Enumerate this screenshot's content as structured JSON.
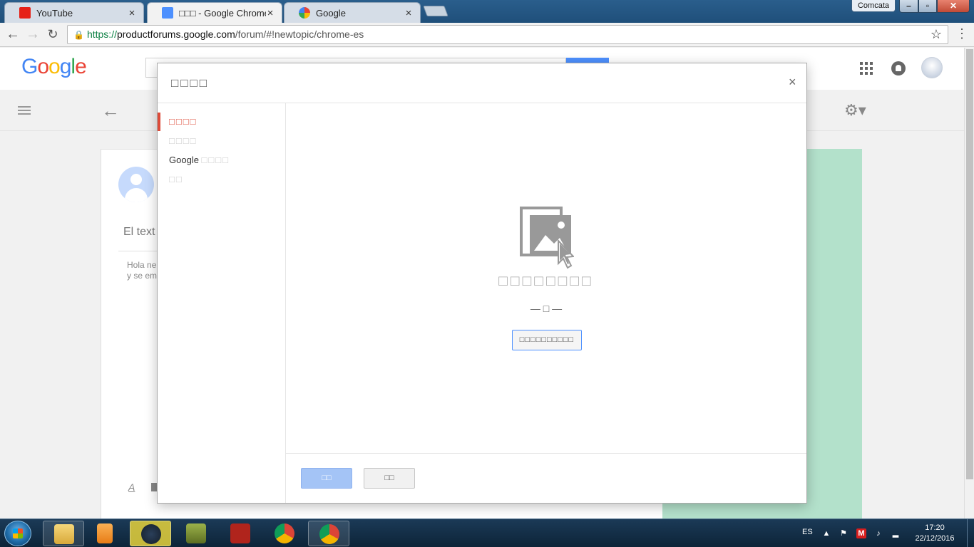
{
  "browser": {
    "tabs": [
      {
        "title": "YouTube",
        "favicon": "youtube-icon",
        "active": false
      },
      {
        "title": "□□□ - Google Chrome - □",
        "favicon": "product-forums-icon",
        "active": true
      },
      {
        "title": "Google",
        "favicon": "google-g-icon",
        "active": false
      }
    ],
    "profile_chip": "Comcata",
    "url": {
      "protocol": "https://",
      "host": "productforums.google.com",
      "path": "/forum/#!newtopic/chrome-es"
    }
  },
  "google_header": {
    "logo": "Google",
    "logo_colors": [
      "#4285f4",
      "#ea4335",
      "#fbbc05",
      "#4285f4",
      "#34a853",
      "#ea4335"
    ]
  },
  "background_card": {
    "title_partial": "El text",
    "body_line1": "Hola ne",
    "body_line2": "y se em"
  },
  "modal": {
    "title": "□□□□",
    "close_glyph": "×",
    "nav": [
      {
        "label": "□□□□",
        "sub": "",
        "state": "active"
      },
      {
        "label": "□□□□",
        "sub": "",
        "state": "disabled"
      },
      {
        "label": "Google",
        "sub": "□□□□",
        "state": "normal"
      },
      {
        "label": "□□",
        "sub": "",
        "state": "disabled"
      }
    ],
    "upload_heading": "□□□□□□□□",
    "or_text": "— □ —",
    "select_button": "□□□□□□□□□□",
    "confirm_button": "□□",
    "cancel_button": "□□"
  },
  "colors": {
    "accent_red": "#dd4b39",
    "accent_blue": "#4d90fe",
    "green_panel": "#b3e1cb"
  },
  "taskbar": {
    "language": "ES",
    "time": "17:20",
    "date": "22/12/2016",
    "apps": [
      "file-explorer-icon",
      "media-player-icon",
      "steam-icon",
      "game-icon",
      "dota2-icon",
      "chrome-icon",
      "chrome-user-icon"
    ]
  }
}
